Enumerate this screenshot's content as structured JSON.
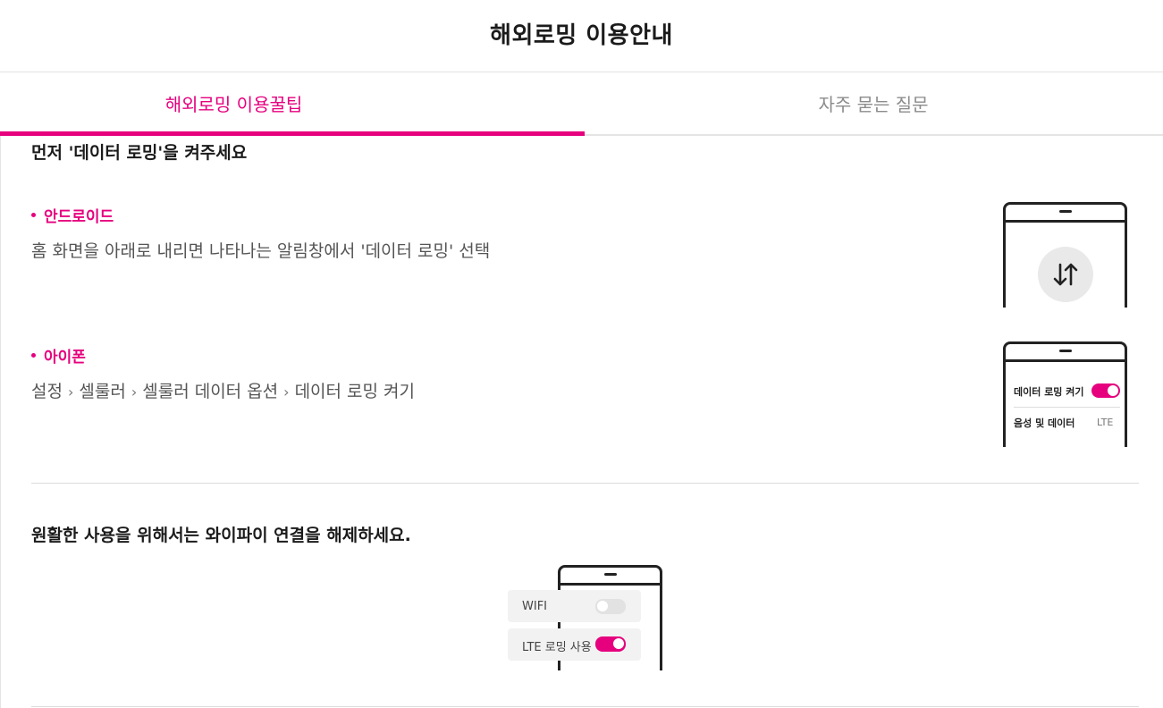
{
  "header": {
    "title": "해외로밍 이용안내"
  },
  "tabs": [
    {
      "label": "해외로밍 이용꿀팁",
      "active": true
    },
    {
      "label": "자주 묻는 질문",
      "active": false
    }
  ],
  "section1": {
    "title": "먼저 '데이터 로밍'을 켜주세요",
    "android": {
      "label": "안드로이드",
      "desc": "홈 화면을 아래로 내리면 나타나는 알림창에서 '데이터 로밍' 선택",
      "icon": "data-arrows-icon"
    },
    "iphone": {
      "label": "아이폰",
      "steps": [
        "설정",
        "셀룰러",
        "셀룰러 데이터 옵션",
        "데이터 로밍 켜기"
      ],
      "separator": "›",
      "screen": {
        "row1_label": "데이터 로밍 켜기",
        "row1_toggle": true,
        "row2_label": "음성 및 데이터",
        "row2_value": "LTE"
      }
    }
  },
  "section2": {
    "title": "원활한 사용을 위해서는 와이파이 연결을 해제하세요.",
    "screen": {
      "wifi_label": "WIFI",
      "wifi_toggle": false,
      "lte_label": "LTE 로밍 사용",
      "lte_toggle": true
    }
  },
  "colors": {
    "accent": "#e6007e",
    "text": "#1b1b1b",
    "muted": "#8c8c8c"
  }
}
